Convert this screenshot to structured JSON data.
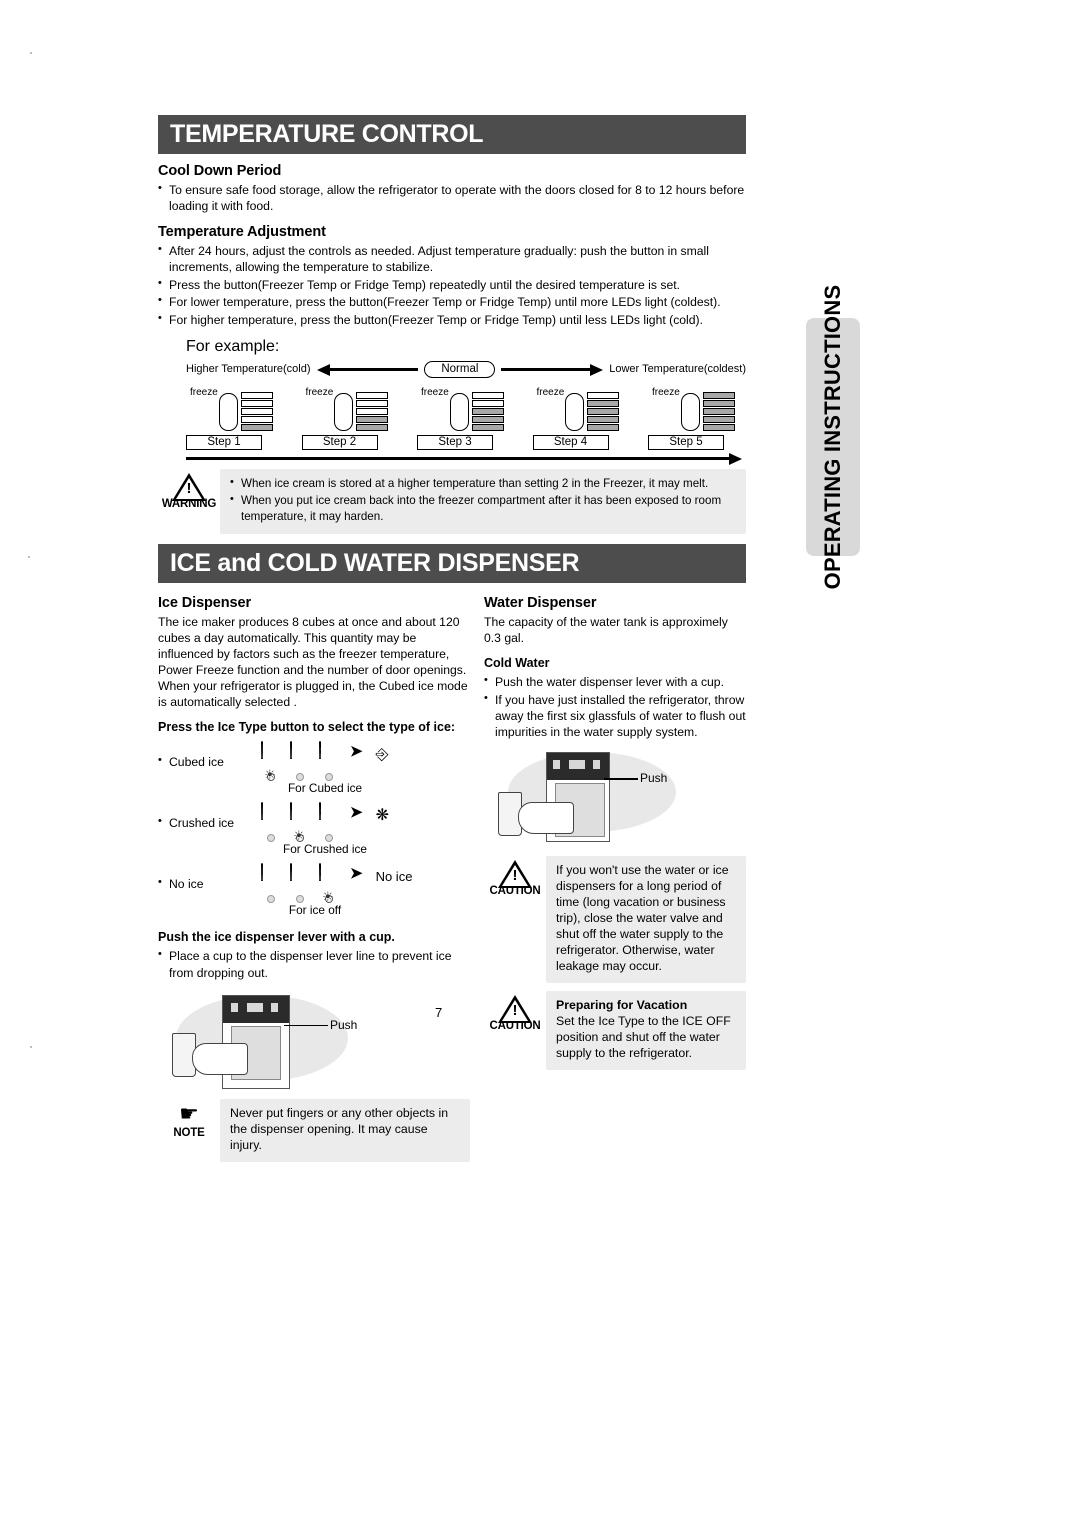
{
  "document": {
    "page_number": "7",
    "side_tab_label": "OPERATING INSTRUCTIONS"
  },
  "section_temperature": {
    "banner_title": "TEMPERATURE CONTROL",
    "cool_down": {
      "heading": "Cool Down Period",
      "bullets": [
        "To ensure safe food storage, allow the refrigerator to operate with the doors closed for 8 to 12 hours before loading it with food."
      ]
    },
    "temp_adjustment": {
      "heading": "Temperature Adjustment",
      "bullets": [
        "After 24 hours, adjust the controls as needed. Adjust temperature gradually: push the button in small increments, allowing the temperature to stabilize.",
        "Press the button(Freezer Temp or Fridge Temp) repeatedly until the desired temperature is set.",
        "For lower temperature, press the button(Freezer Temp or Fridge Temp) until more LEDs light (coldest).",
        "For higher temperature, press the button(Freezer Temp or Fridge Temp) until less LEDs light (cold)."
      ]
    },
    "example": {
      "title": "For example:",
      "left_label": "Higher Temperature(cold)",
      "center_label": "Normal",
      "right_label": "Lower Temperature(coldest)",
      "panel_label": "freeze",
      "steps": [
        {
          "label": "Step 1",
          "leds": [
            0,
            0,
            0,
            0,
            1
          ]
        },
        {
          "label": "Step 2",
          "leds": [
            0,
            0,
            0,
            1,
            1
          ]
        },
        {
          "label": "Step 3",
          "leds": [
            0,
            0,
            1,
            1,
            1
          ]
        },
        {
          "label": "Step 4",
          "leds": [
            0,
            1,
            1,
            1,
            1
          ]
        },
        {
          "label": "Step 5",
          "leds": [
            1,
            1,
            1,
            1,
            1
          ]
        }
      ]
    },
    "warning": {
      "label": "WARNING",
      "bullets": [
        "When ice cream is stored at a higher temperature than setting 2 in the Freezer, it may melt.",
        "When you put ice cream back into the freezer compartment after it has been exposed to room temperature, it may harden."
      ]
    }
  },
  "section_dispenser": {
    "banner_title": "ICE and COLD WATER DISPENSER",
    "ice_dispenser": {
      "heading": "Ice Dispenser",
      "paragraph": "The ice maker produces 8 cubes at once and about 120 cubes a day automatically. This quantity may be influenced by factors such as the freezer temperature, Power Freeze function and the number of door openings. When your refrigerator is plugged in, the Cubed ice mode is automatically selected .",
      "ice_type_heading": "Press the Ice Type button to select the type of ice:",
      "glass_icons": [
        "cubed-ice-glass-icon",
        "crushed-ice-glass-icon",
        "ice-off-glass-icon"
      ],
      "ice_off_text": "ICE\nOFF",
      "rows": [
        {
          "label": "Cubed ice",
          "lit_index": 0,
          "caption": "For Cubed ice",
          "result_kind": "icon",
          "result": "cubed-ice-result-icon"
        },
        {
          "label": "Crushed ice",
          "lit_index": 1,
          "caption": "For Crushed ice",
          "result_kind": "icon",
          "result": "crushed-ice-result-icon"
        },
        {
          "label": "No ice",
          "lit_index": 2,
          "caption": "For ice off",
          "result_kind": "text",
          "result": "No ice"
        }
      ],
      "lever_heading": "Push the ice dispenser lever with a cup.",
      "lever_bullets": [
        "Place a cup to the dispenser lever line to prevent ice from dropping out."
      ],
      "illustration_push_label": "Push"
    },
    "note": {
      "label": "NOTE",
      "text": "Never put fingers or any other objects in the dispenser opening. It may cause injury."
    },
    "water_dispenser": {
      "heading": "Water Dispenser",
      "paragraph": "The capacity of the water tank is approximely 0.3 gal.",
      "cold_water_heading": "Cold Water",
      "cold_water_bullets": [
        "Push the water dispenser lever with a cup.",
        "If you have just installed the refrigerator, throw away the first six glassfuls of water to flush out impurities in the water supply system."
      ],
      "illustration_push_label": "Push"
    },
    "caution_long_trip": {
      "label": "CAUTION",
      "text": "If you won't use the water or ice dispensers for a long period of time (long vacation or business trip), close the water valve and shut off the water supply to the refrigerator. Otherwise, water  leakage may occur."
    },
    "caution_vacation": {
      "label": "CAUTION",
      "heading": "Preparing for Vacation",
      "text": "Set the Ice Type to the ICE OFF position and shut off the water supply to the refrigerator."
    }
  },
  "colors": {
    "banner_bg": "#4d4d4d",
    "alert_bg": "#ececec",
    "led_on": "#a8a8a8",
    "tab_bg": "#d9d9d9"
  }
}
